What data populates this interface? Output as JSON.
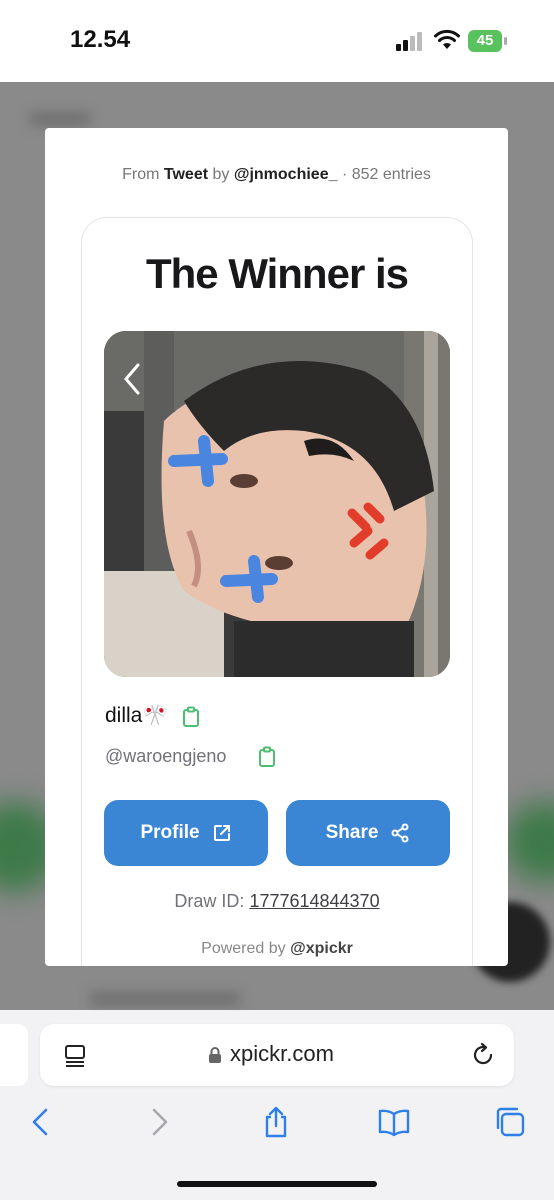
{
  "status_bar": {
    "time": "12.54",
    "battery": "45"
  },
  "modal": {
    "source_prefix": "From",
    "source_name": "Tweet",
    "source_by": "by",
    "source_handle": "@jnmochiee_",
    "source_suffix": "· 852 entries",
    "title": "The Winner is",
    "winner_name": "dilla🎌",
    "winner_handle": "@waroengjeno",
    "profile_button": "Profile",
    "share_button": "Share",
    "draw_id_label": "Draw ID:",
    "draw_id_value": "1777614844370",
    "powered_label": "Powered by",
    "powered_handle": "@xpickr"
  },
  "browser": {
    "url": "xpickr.com"
  },
  "icons": {
    "copy": "clipboard-icon",
    "external": "external-link-icon",
    "share": "share-nodes-icon",
    "nav": [
      "back-icon",
      "forward-icon",
      "share-icon",
      "bookmarks-icon",
      "tabs-icon"
    ]
  },
  "colors": {
    "accent": "#3a86d4",
    "copy_icon": "#4cbf72",
    "battery": "#5ac15f"
  }
}
